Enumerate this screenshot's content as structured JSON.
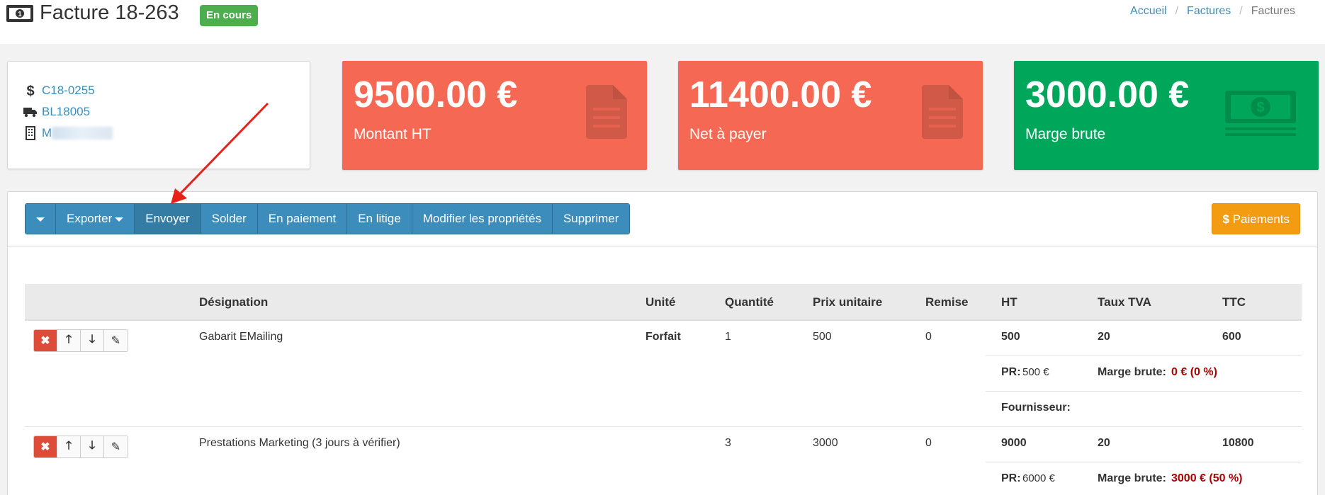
{
  "header": {
    "title": "Facture 18-263",
    "status": "En cours",
    "breadcrumb": [
      "Accueil",
      "Factures",
      "Factures"
    ]
  },
  "info": {
    "client_code": "C18-0255",
    "delivery_note": "BL18005",
    "company": "M"
  },
  "stats": [
    {
      "value": "9500.00 €",
      "label": "Montant HT",
      "color": "#f56954",
      "icon": "file-icon"
    },
    {
      "value": "11400.00 €",
      "label": "Net à payer",
      "color": "#f56954",
      "icon": "file-icon"
    },
    {
      "value": "3000.00 €",
      "label": "Marge brute",
      "color": "#00a65a",
      "icon": "money-icon"
    }
  ],
  "toolbar": {
    "export": "Exporter",
    "send": "Envoyer",
    "settle": "Solder",
    "in_payment": "En paiement",
    "disputed": "En litige",
    "edit_properties": "Modifier les propriétés",
    "delete": "Supprimer",
    "payments": "Paiements"
  },
  "table": {
    "headers": {
      "designation": "Désignation",
      "unit": "Unité",
      "quantity": "Quantité",
      "unit_price": "Prix unitaire",
      "discount": "Remise",
      "ht": "HT",
      "vat": "Taux TVA",
      "ttc": "TTC"
    },
    "rows": [
      {
        "designation": "Gabarit EMailing",
        "unit": "Forfait",
        "quantity": "1",
        "unit_price": "500",
        "discount": "0",
        "ht": "500",
        "vat": "20",
        "ttc": "600",
        "pr_label": "PR:",
        "pr_value": "500 €",
        "margin_label": "Marge brute:",
        "margin_value": "0 € (0 %)",
        "supplier_label": "Fournisseur:"
      },
      {
        "designation": "Prestations Marketing (3 jours à vérifier)",
        "unit": "",
        "quantity": "3",
        "unit_price": "3000",
        "discount": "0",
        "ht": "9000",
        "vat": "20",
        "ttc": "10800",
        "pr_label": "PR:",
        "pr_value": "6000 €",
        "margin_label": "Marge brute:",
        "margin_value": "3000 € (50 %)"
      }
    ]
  },
  "colors": {
    "primary": "#3c8dbc",
    "danger": "#f56954",
    "success": "#00a65a",
    "warning": "#f39c12",
    "annotation_arrow": "#e8201a"
  }
}
